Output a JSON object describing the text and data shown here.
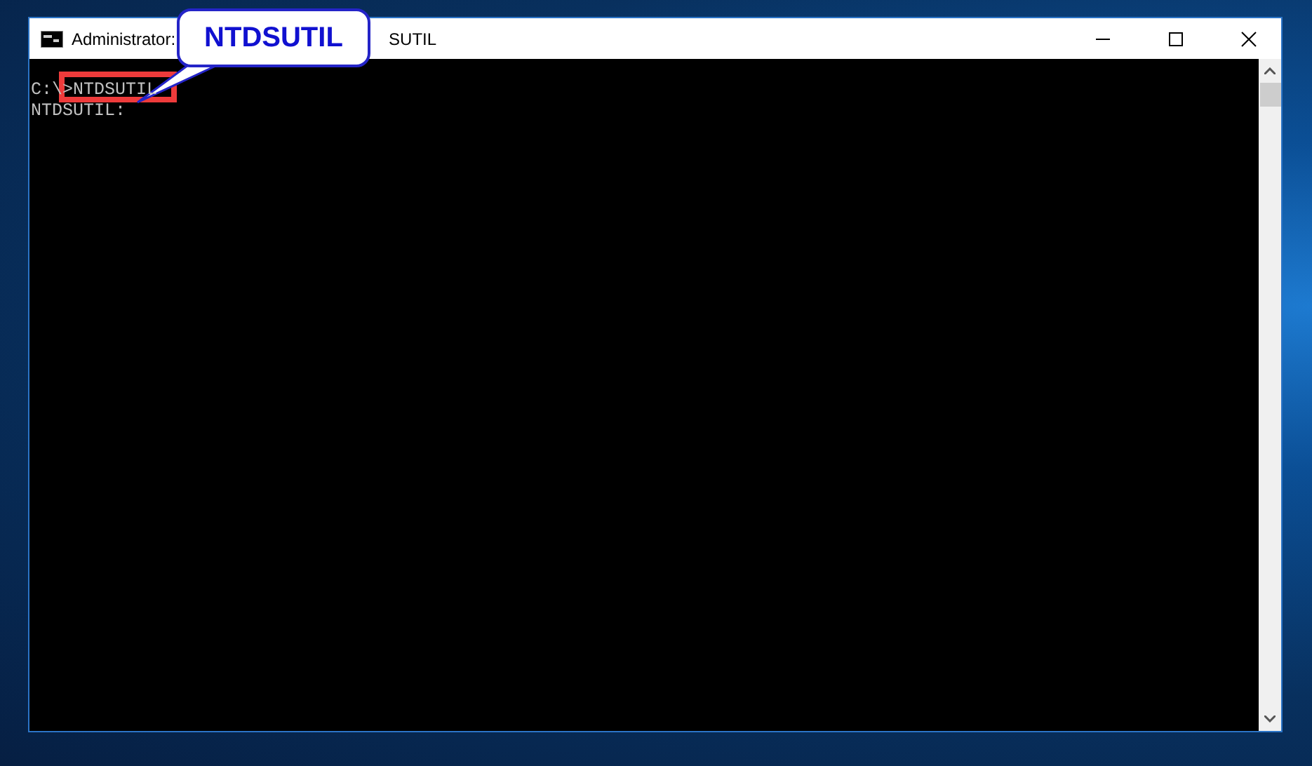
{
  "window": {
    "title_start": "Administrator:",
    "title_end": "SUTIL"
  },
  "console": {
    "lines": [
      "C:\\>NTDSUTIL",
      "NTDSUTIL:"
    ]
  },
  "callout": {
    "text": "NTDSUTIL"
  }
}
